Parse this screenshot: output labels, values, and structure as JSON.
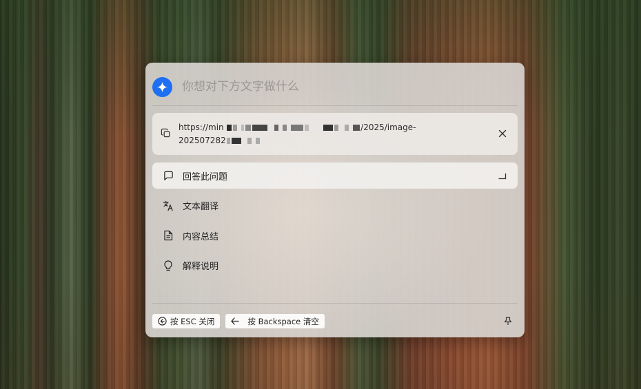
{
  "prompt": {
    "placeholder": "你想对下方文字做什么",
    "value": ""
  },
  "attachment": {
    "url_line1_start": "https://min",
    "url_line1_end": "/2025/image-",
    "url_line2_start": "202507282"
  },
  "actions": [
    {
      "label": "回答此问题",
      "icon": "message-icon",
      "active": true
    },
    {
      "label": "文本翻译",
      "icon": "translate-icon",
      "active": false
    },
    {
      "label": "内容总结",
      "icon": "document-icon",
      "active": false
    },
    {
      "label": "解释说明",
      "icon": "lightbulb-icon",
      "active": false
    }
  ],
  "footer": {
    "esc_label": "按 ESC 关闭",
    "backspace_label": "按 Backspace 清空"
  },
  "colors": {
    "accent": "#1e6ff2",
    "dialog_bg": "#d6d2cd"
  }
}
